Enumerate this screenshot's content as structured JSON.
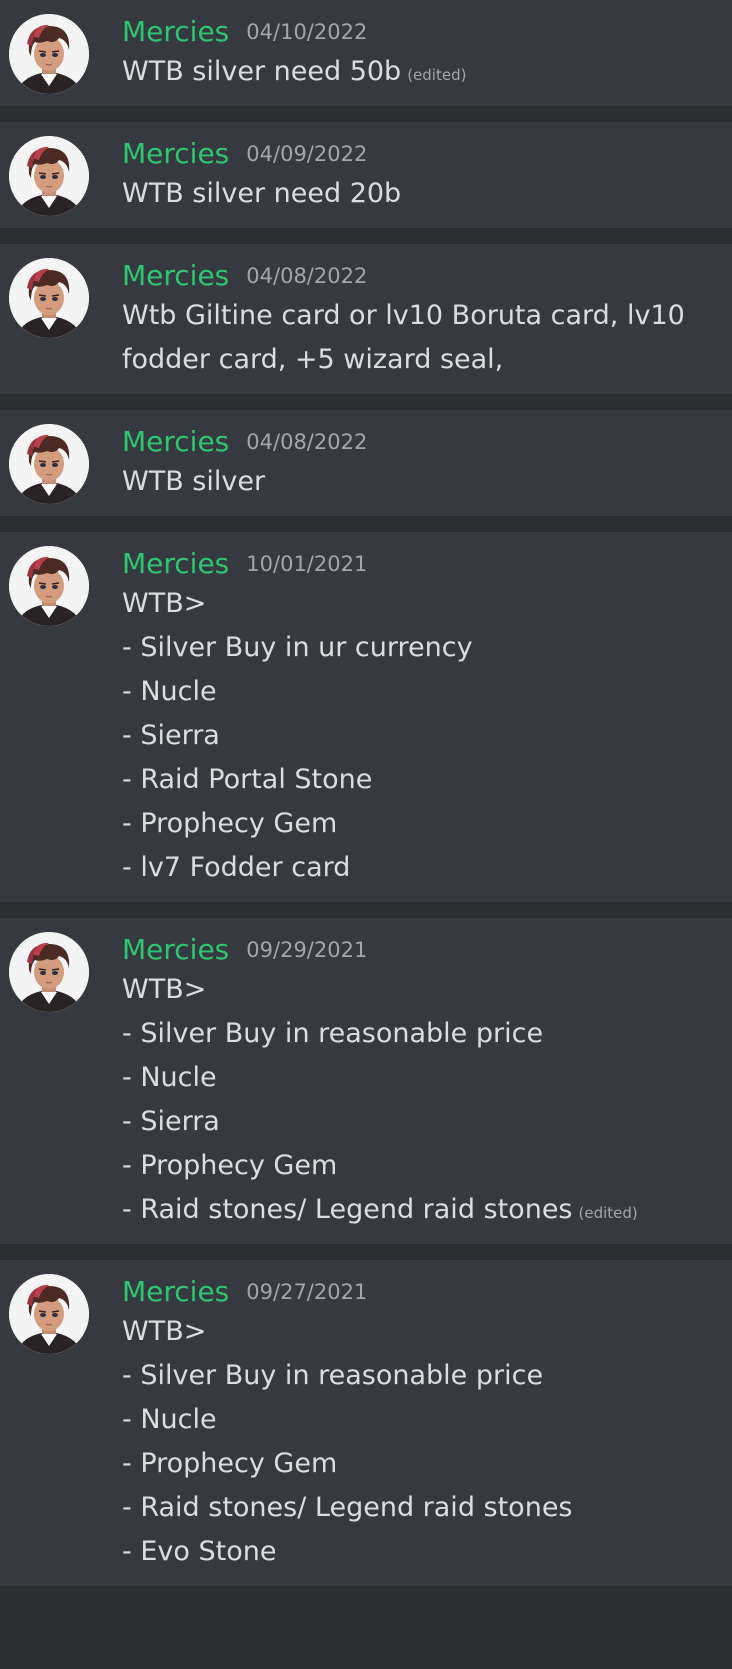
{
  "theme": {
    "username_color": "#2dc770",
    "bg": "#36393f",
    "separator": "#2b2d31",
    "text": "#dcddde",
    "muted": "#a3a6aa"
  },
  "edited_label": "(edited)",
  "messages": [
    {
      "author": "Mercies",
      "timestamp": "04/10/2022",
      "avatar_icon": "user-avatar-icon",
      "lines": [
        "WTB silver need 50b"
      ],
      "edited": true
    },
    {
      "author": "Mercies",
      "timestamp": "04/09/2022",
      "avatar_icon": "user-avatar-icon",
      "lines": [
        "WTB silver need 20b"
      ],
      "edited": false
    },
    {
      "author": "Mercies",
      "timestamp": "04/08/2022",
      "avatar_icon": "user-avatar-icon",
      "lines": [
        "Wtb Giltine card or lv10 Boruta card, lv10",
        "fodder card, +5 wizard seal,"
      ],
      "edited": false
    },
    {
      "author": "Mercies",
      "timestamp": "04/08/2022",
      "avatar_icon": "user-avatar-icon",
      "lines": [
        "WTB silver"
      ],
      "edited": false
    },
    {
      "author": "Mercies",
      "timestamp": "10/01/2021",
      "avatar_icon": "user-avatar-icon",
      "lines": [
        "WTB>",
        "- Silver Buy in ur currency",
        "- Nucle",
        "- Sierra",
        "- Raid Portal Stone",
        "- Prophecy Gem",
        "- lv7 Fodder card"
      ],
      "edited": false
    },
    {
      "author": "Mercies",
      "timestamp": "09/29/2021",
      "avatar_icon": "user-avatar-icon",
      "lines": [
        "WTB>",
        "- Silver Buy in reasonable price",
        "- Nucle",
        "- Sierra",
        "- Prophecy Gem",
        "- Raid stones/ Legend raid stones"
      ],
      "edited": true
    },
    {
      "author": "Mercies",
      "timestamp": "09/27/2021",
      "avatar_icon": "user-avatar-icon",
      "lines": [
        "WTB>",
        "- Silver Buy in reasonable price",
        "- Nucle",
        "- Prophecy Gem",
        "- Raid stones/ Legend raid stones",
        "- Evo Stone"
      ],
      "edited": false
    }
  ]
}
